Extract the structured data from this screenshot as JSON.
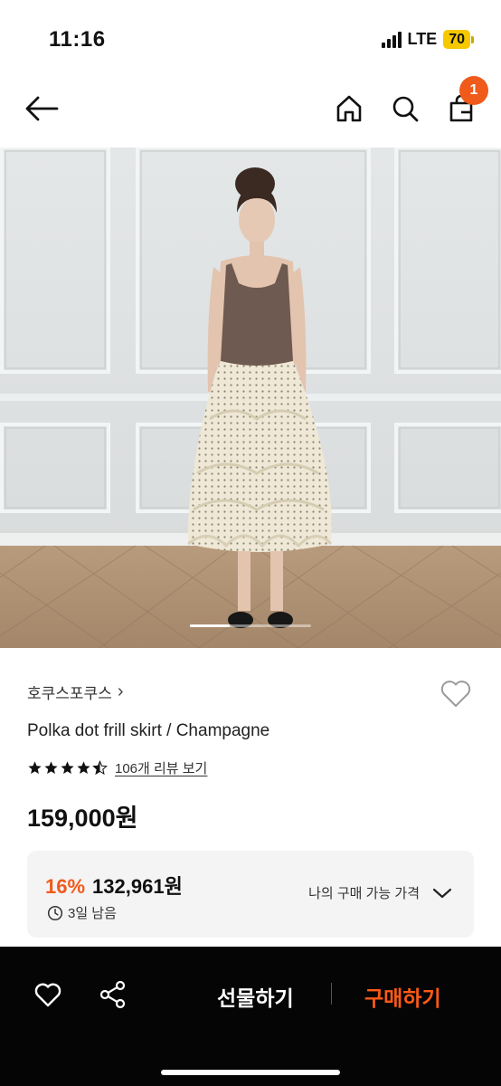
{
  "status": {
    "time": "11:16",
    "network": "LTE",
    "battery": "70"
  },
  "nav": {
    "back_icon": "arrow-left-icon",
    "home_icon": "home-icon",
    "search_icon": "search-icon",
    "cart_icon": "shopping-bag-icon",
    "cart_badge": "1",
    "badge_color": "#f05a1a"
  },
  "product": {
    "brand": "호쿠스포쿠스",
    "brand_chevron": "›",
    "name": "Polka dot frill skirt / Champagne",
    "rating": 4.5,
    "review_link": "106개 리뷰 보기",
    "price": "159,000원"
  },
  "image_carousel": {
    "progress": 0.33
  },
  "deal": {
    "discount": "16%",
    "deal_price": "132,961원",
    "timer": "3일 남음",
    "my_price_label": "나의 구매 가능 가격",
    "accent": "#f05a1a"
  },
  "bottom_bar": {
    "gift_label": "선물하기",
    "buy_label": "구매하기",
    "buy_color": "#ff5a17"
  }
}
